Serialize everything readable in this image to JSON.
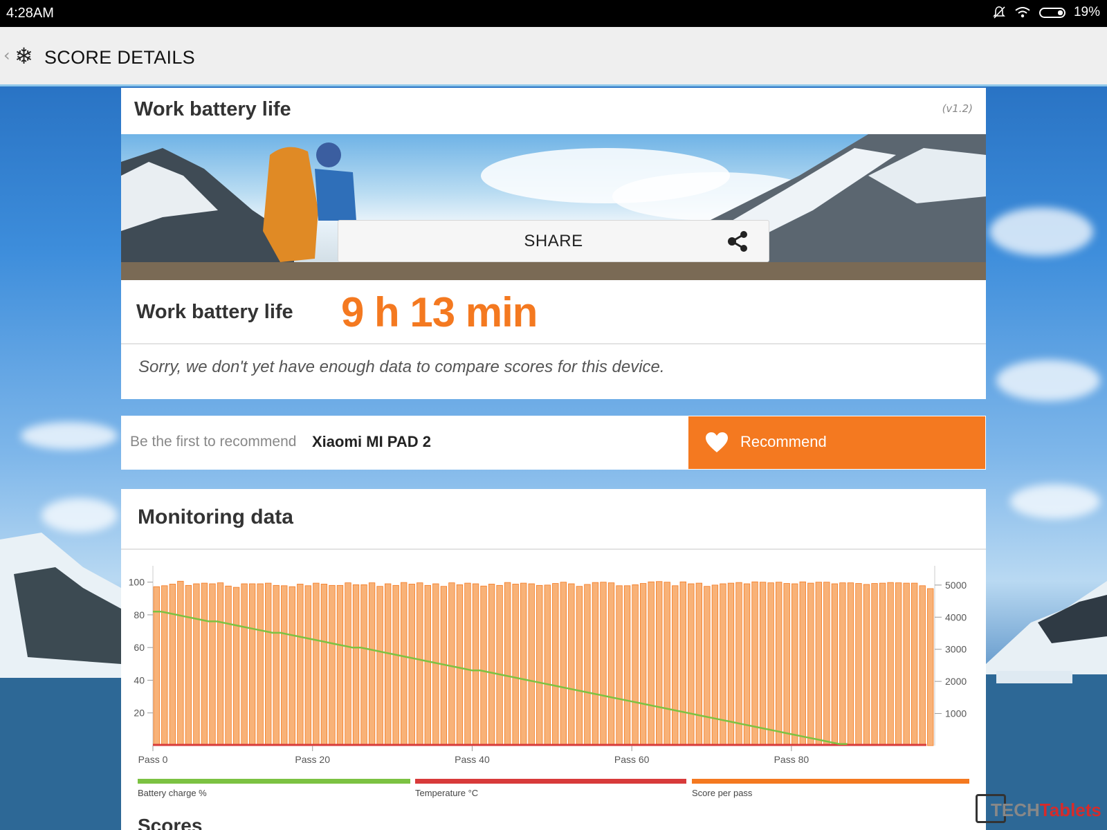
{
  "status_bar": {
    "time": "4:28AM",
    "battery_percent": "19%"
  },
  "app_bar": {
    "title": "SCORE DETAILS"
  },
  "result_card": {
    "heading": "Work battery life",
    "version": "(v1.2)",
    "share_label": "SHARE",
    "score_label": "Work battery life",
    "score_value": "9 h 13 min",
    "compare_message": "Sorry, we don't yet have enough data to compare scores for this device."
  },
  "recommend": {
    "prompt": "Be the first to recommend",
    "device": "Xiaomi MI PAD 2",
    "button_label": "Recommend"
  },
  "monitoring": {
    "title": "Monitoring data",
    "legend": [
      {
        "label": "Battery charge %",
        "color": "#7cc242"
      },
      {
        "label": "Temperature °C",
        "color": "#d83a3a"
      },
      {
        "label": "Score per pass",
        "color": "#f47920"
      }
    ]
  },
  "next_section_title": "Scores",
  "watermark": {
    "part1": "TECH",
    "part2": "Tablets"
  },
  "chart_data": {
    "type": "bar",
    "left_axis": {
      "ticks": [
        20,
        40,
        60,
        80,
        100
      ],
      "ylim": [
        0,
        110
      ]
    },
    "right_axis": {
      "ticks": [
        1000,
        2000,
        3000,
        4000,
        5000
      ],
      "ylim": [
        0,
        5600
      ]
    },
    "x_tick_labels": [
      "Pass 0",
      "Pass 20",
      "Pass 40",
      "Pass 60",
      "Pass 80"
    ],
    "x_tick_positions": [
      0,
      20,
      40,
      60,
      80
    ],
    "series": [
      {
        "name": "Score per pass",
        "axis": "right",
        "color": "#f47920",
        "values": [
          4950,
          4980,
          5030,
          5120,
          4990,
          5040,
          5060,
          5040,
          5070,
          4970,
          4930,
          5040,
          5040,
          5040,
          5060,
          4990,
          4980,
          4950,
          5030,
          4980,
          5060,
          5030,
          4990,
          4990,
          5070,
          5010,
          5010,
          5070,
          4960,
          5040,
          4990,
          5080,
          5030,
          5070,
          4990,
          5040,
          4960,
          5070,
          5010,
          5060,
          5040,
          4970,
          5030,
          4990,
          5080,
          5030,
          5060,
          5040,
          4990,
          5000,
          5050,
          5090,
          5040,
          4960,
          5020,
          5080,
          5090,
          5070,
          4980,
          4980,
          5010,
          5050,
          5100,
          5110,
          5090,
          4980,
          5100,
          5040,
          5060,
          4960,
          5000,
          5040,
          5060,
          5080,
          5040,
          5100,
          5090,
          5070,
          5090,
          5050,
          5040,
          5100,
          5060,
          5090,
          5090,
          5040,
          5070,
          5070,
          5050,
          5020,
          5050,
          5060,
          5080,
          5070,
          5060,
          5060,
          4980,
          4890
        ],
        "x": "pass index 0-97"
      },
      {
        "name": "Battery charge %",
        "axis": "left",
        "color": "#7cc242",
        "points": [
          [
            0,
            82
          ],
          [
            1,
            82
          ],
          [
            2,
            81
          ],
          [
            3,
            80
          ],
          [
            4,
            79
          ],
          [
            5,
            78
          ],
          [
            6,
            77
          ],
          [
            7,
            76
          ],
          [
            8,
            76
          ],
          [
            9,
            75
          ],
          [
            10,
            74
          ],
          [
            11,
            73
          ],
          [
            12,
            72
          ],
          [
            13,
            71
          ],
          [
            14,
            70
          ],
          [
            15,
            69
          ],
          [
            16,
            69
          ],
          [
            17,
            68
          ],
          [
            18,
            67
          ],
          [
            19,
            66
          ],
          [
            20,
            65
          ],
          [
            21,
            64
          ],
          [
            22,
            63
          ],
          [
            23,
            62
          ],
          [
            24,
            61
          ],
          [
            25,
            60
          ],
          [
            26,
            60
          ],
          [
            27,
            59
          ],
          [
            28,
            58
          ],
          [
            29,
            57
          ],
          [
            30,
            56
          ],
          [
            31,
            55
          ],
          [
            32,
            54
          ],
          [
            33,
            53
          ],
          [
            34,
            52
          ],
          [
            35,
            51
          ],
          [
            36,
            50
          ],
          [
            37,
            49
          ],
          [
            38,
            48
          ],
          [
            39,
            47
          ],
          [
            40,
            46
          ],
          [
            41,
            46
          ],
          [
            42,
            45
          ],
          [
            43,
            44
          ],
          [
            44,
            43
          ],
          [
            45,
            42
          ],
          [
            46,
            41
          ],
          [
            47,
            40
          ],
          [
            48,
            39
          ],
          [
            49,
            38
          ],
          [
            50,
            37
          ],
          [
            51,
            36
          ],
          [
            52,
            35
          ],
          [
            53,
            34
          ],
          [
            54,
            33
          ],
          [
            55,
            32
          ],
          [
            56,
            31
          ],
          [
            57,
            30
          ],
          [
            58,
            29
          ],
          [
            59,
            28
          ],
          [
            60,
            27
          ],
          [
            61,
            26
          ],
          [
            62,
            25
          ],
          [
            63,
            24
          ],
          [
            64,
            23
          ],
          [
            65,
            22
          ],
          [
            66,
            21
          ],
          [
            67,
            20
          ],
          [
            68,
            19
          ],
          [
            69,
            18
          ],
          [
            70,
            17
          ],
          [
            71,
            16
          ],
          [
            72,
            15
          ],
          [
            73,
            14
          ],
          [
            74,
            13
          ],
          [
            75,
            12
          ],
          [
            76,
            11
          ],
          [
            77,
            10
          ],
          [
            78,
            9
          ],
          [
            79,
            8
          ],
          [
            80,
            7
          ],
          [
            81,
            6
          ],
          [
            82,
            5
          ],
          [
            83,
            4
          ],
          [
            84,
            3
          ],
          [
            85,
            2
          ],
          [
            86,
            1
          ],
          [
            87,
            1
          ]
        ],
        "note_visible": false
      },
      {
        "name": "Temperature °C",
        "axis": "left",
        "color": "#d83a3a",
        "values_flat": 0
      }
    ]
  }
}
